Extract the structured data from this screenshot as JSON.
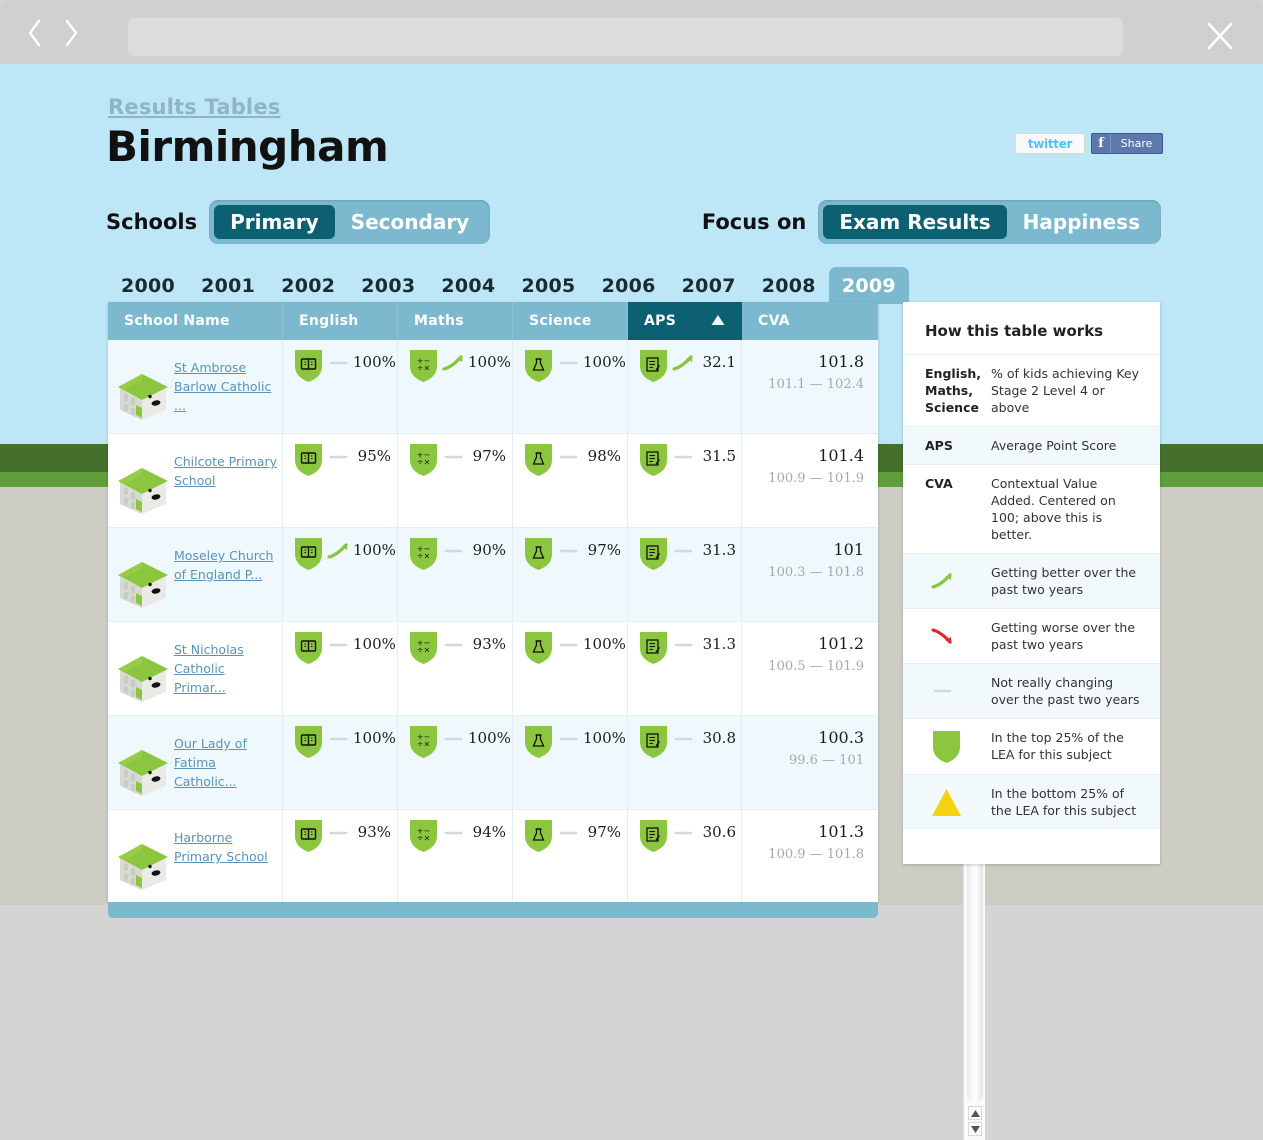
{
  "browser": {
    "back_icon": "chevron-left-icon",
    "forward_icon": "chevron-right-icon",
    "address_value": "",
    "address_placeholder": "",
    "close_icon": "close-icon"
  },
  "header": {
    "breadcrumb": "Results Tables",
    "title": "Birmingham",
    "twitter_label": "twitter",
    "facebook_f": "f",
    "facebook_label": "Share"
  },
  "toggles": {
    "schools": {
      "label": "Schools",
      "options": [
        "Primary",
        "Secondary"
      ],
      "selected": "Primary"
    },
    "focus": {
      "label": "Focus on",
      "options": [
        "Exam Results",
        "Happiness"
      ],
      "selected": "Exam Results"
    }
  },
  "years": {
    "items": [
      "2000",
      "2001",
      "2002",
      "2003",
      "2004",
      "2005",
      "2006",
      "2007",
      "2008",
      "2009"
    ],
    "selected": "2009"
  },
  "table": {
    "columns": [
      "School Name",
      "English",
      "Maths",
      "Science",
      "APS",
      "CVA"
    ],
    "sorted_column": "APS",
    "sort_direction": "ascending",
    "sort_caret": "triangle-up-icon",
    "rows": [
      {
        "school": "St Ambrose Barlow Catholic ...",
        "english": {
          "value": "100%",
          "trend": "flat",
          "rank": "top"
        },
        "maths": {
          "value": "100%",
          "trend": "up",
          "rank": "top"
        },
        "science": {
          "value": "100%",
          "trend": "flat",
          "rank": "top"
        },
        "aps": {
          "value": "32.1",
          "trend": "up",
          "rank": "top"
        },
        "cva": {
          "value": "101.8",
          "range": "101.1 — 102.4"
        }
      },
      {
        "school": "Chilcote Primary School",
        "english": {
          "value": "95%",
          "trend": "flat",
          "rank": "top"
        },
        "maths": {
          "value": "97%",
          "trend": "flat",
          "rank": "top"
        },
        "science": {
          "value": "98%",
          "trend": "flat",
          "rank": "top"
        },
        "aps": {
          "value": "31.5",
          "trend": "flat",
          "rank": "top"
        },
        "cva": {
          "value": "101.4",
          "range": "100.9 — 101.9"
        }
      },
      {
        "school": "Moseley Church of England P...",
        "english": {
          "value": "100%",
          "trend": "up",
          "rank": "top"
        },
        "maths": {
          "value": "90%",
          "trend": "flat",
          "rank": "top"
        },
        "science": {
          "value": "97%",
          "trend": "flat",
          "rank": "top"
        },
        "aps": {
          "value": "31.3",
          "trend": "flat",
          "rank": "top"
        },
        "cva": {
          "value": "101",
          "range": "100.3 — 101.8"
        }
      },
      {
        "school": "St Nicholas Catholic Primar...",
        "english": {
          "value": "100%",
          "trend": "flat",
          "rank": "top"
        },
        "maths": {
          "value": "93%",
          "trend": "flat",
          "rank": "top"
        },
        "science": {
          "value": "100%",
          "trend": "flat",
          "rank": "top"
        },
        "aps": {
          "value": "31.3",
          "trend": "flat",
          "rank": "top"
        },
        "cva": {
          "value": "101.2",
          "range": "100.5 — 101.9"
        }
      },
      {
        "school": "Our Lady of Fatima Catholic...",
        "english": {
          "value": "100%",
          "trend": "flat",
          "rank": "top"
        },
        "maths": {
          "value": "100%",
          "trend": "flat",
          "rank": "top"
        },
        "science": {
          "value": "100%",
          "trend": "flat",
          "rank": "top"
        },
        "aps": {
          "value": "30.8",
          "trend": "flat",
          "rank": "top"
        },
        "cva": {
          "value": "100.3",
          "range": "99.6 — 101"
        }
      },
      {
        "school": "Harborne Primary School",
        "english": {
          "value": "93%",
          "trend": "flat",
          "rank": "top"
        },
        "maths": {
          "value": "94%",
          "trend": "flat",
          "rank": "top"
        },
        "science": {
          "value": "97%",
          "trend": "flat",
          "rank": "top"
        },
        "aps": {
          "value": "30.6",
          "trend": "flat",
          "rank": "top"
        },
        "cva": {
          "value": "101.3",
          "range": "100.9 — 101.8"
        }
      }
    ]
  },
  "scrollbar": {
    "up_icon": "triangle-up-icon",
    "down_icon": "triangle-down-icon",
    "thumb_icon": "scroll-thumb"
  },
  "legend": {
    "title": "How this table works",
    "rows": [
      {
        "key": "English, Maths, Science",
        "icon": null,
        "desc": "% of kids achieving Key Stage 2 Level 4 or above"
      },
      {
        "key": "APS",
        "icon": null,
        "desc": "Average Point Score"
      },
      {
        "key": "CVA",
        "icon": null,
        "desc": "Contextual Value Added. Centered on 100; above this is better."
      },
      {
        "key": null,
        "icon": "trend-up-icon",
        "desc": "Getting better over the past two years"
      },
      {
        "key": null,
        "icon": "trend-down-icon",
        "desc": "Getting worse over the past two years"
      },
      {
        "key": null,
        "icon": "trend-flat-icon",
        "desc": "Not really changing over the past two years"
      },
      {
        "key": null,
        "icon": "green-shield-icon",
        "desc": "In the top 25% of the LEA for this subject"
      },
      {
        "key": null,
        "icon": "yellow-triangle-icon",
        "desc": "In the bottom 25% of the LEA for this subject"
      }
    ]
  },
  "colors": {
    "page_bg": "#bde6f7",
    "accent_teal": "#0d5f72",
    "header_blue": "#7cb9cf",
    "shield_green": "#8cc63e",
    "trend_up": "#8cc63e",
    "trend_down": "#d92b2b",
    "triangle_yellow": "#f5d312",
    "band_green": "#44702c"
  }
}
